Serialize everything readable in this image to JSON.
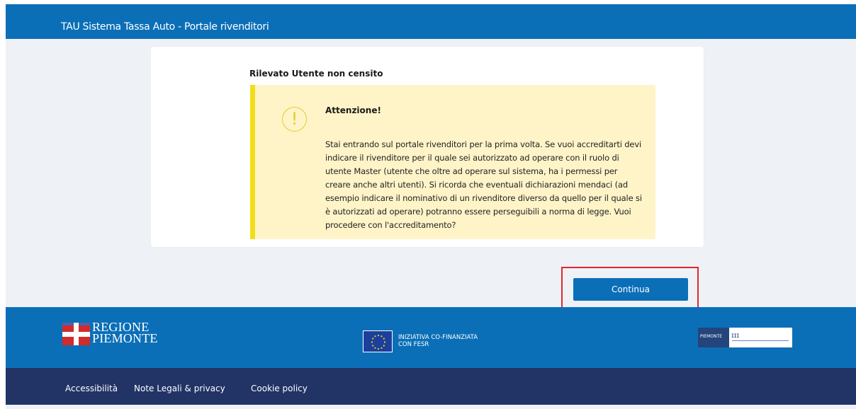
{
  "header": {
    "title": "TAU Sistema Tassa Auto - Portale rivenditori"
  },
  "card": {
    "title": "Rilevato Utente non censito",
    "alert": {
      "icon": "exclamation-icon",
      "heading": "Attenzione!",
      "body": "Stai entrando sul portale rivenditori per la prima volta. Se vuoi accreditarti devi indicare il rivenditore per il quale sei autorizzato ad operare con il ruolo di utente Master (utente che oltre ad operare sul sistema, ha i permessi per creare anche altri utenti). Si ricorda che eventuali dichiarazioni mendaci (ad esempio indicare il nominativo di un rivenditore diverso da quello per il quale si è autorizzati ad operare) potranno essere perseguibili a norma di legge. Vuoi procedere con l'accreditamento?"
    }
  },
  "actions": {
    "continue_label": "Continua"
  },
  "footer": {
    "regione_line1": "REGIONE",
    "regione_line2": "PIEMONTE",
    "eu_line1": "INIZIATIVA CO-FINANZIATA",
    "eu_line2": "CON FESR",
    "partner_text": "PIEMONTE",
    "links": [
      "Accessibilità",
      "Note Legali & privacy",
      "Cookie policy"
    ]
  },
  "colors": {
    "primary": "#0b6fb8",
    "footer_dark": "#223366",
    "alert_bg": "#fff4c8",
    "alert_border": "#f2dd1a",
    "highlight": "#e3262e"
  }
}
